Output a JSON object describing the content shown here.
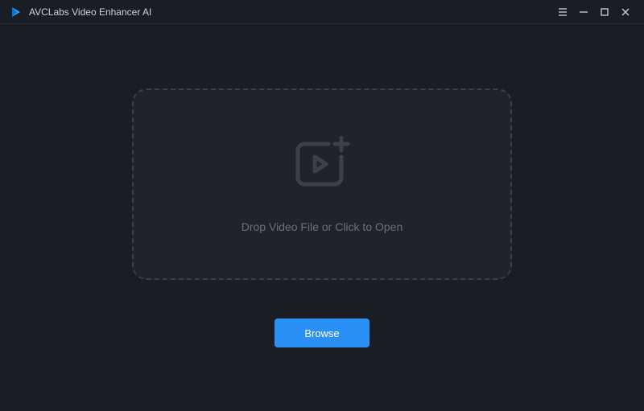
{
  "header": {
    "app_title": "AVCLabs Video Enhancer AI"
  },
  "main": {
    "drop_text": "Drop Video File or Click to Open",
    "browse_label": "Browse"
  }
}
